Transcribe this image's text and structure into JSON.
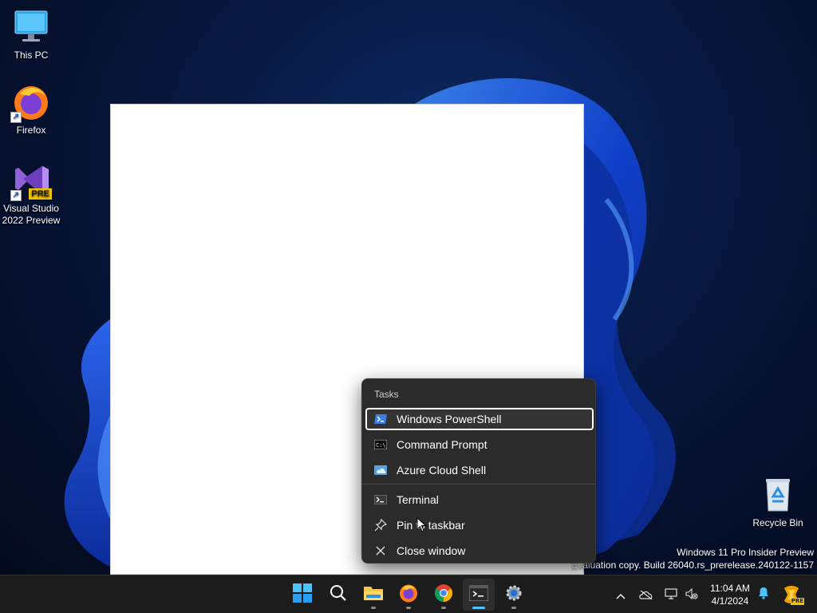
{
  "desktop": {
    "icons": [
      {
        "label": "This PC",
        "icon": "monitor-icon"
      },
      {
        "label": "Firefox",
        "icon": "firefox-icon"
      },
      {
        "label": "Visual Studio 2022 Preview",
        "icon": "visual-studio-icon",
        "badge": "PRE"
      },
      {
        "label": "Recycle Bin",
        "icon": "recycle-bin-icon"
      }
    ],
    "watermark": {
      "line1": "Windows 11 Pro Insider Preview",
      "line2": "Evaluation copy. Build 26040.rs_prerelease.240122-1157"
    }
  },
  "jumplist": {
    "section_title": "Tasks",
    "profiles": [
      {
        "label": "Windows PowerShell",
        "icon": "powershell-icon",
        "selected": true
      },
      {
        "label": "Command Prompt",
        "icon": "command-prompt-icon",
        "selected": false
      },
      {
        "label": "Azure Cloud Shell",
        "icon": "azure-cloud-shell-icon",
        "selected": false
      }
    ],
    "actions": [
      {
        "label": "Terminal",
        "icon": "terminal-icon"
      },
      {
        "label": "Pin to taskbar",
        "icon": "pin-icon"
      },
      {
        "label": "Close window",
        "icon": "close-icon"
      }
    ]
  },
  "taskbar": {
    "apps": [
      {
        "name": "Start",
        "icon": "windows-start-icon"
      },
      {
        "name": "Search",
        "icon": "search-icon"
      },
      {
        "name": "File Explorer",
        "icon": "file-explorer-icon",
        "running": true
      },
      {
        "name": "Firefox",
        "icon": "firefox-icon",
        "running": true
      },
      {
        "name": "Google Chrome",
        "icon": "chrome-icon",
        "running": true
      },
      {
        "name": "Terminal",
        "icon": "terminal-icon",
        "running": true,
        "active": true
      },
      {
        "name": "Settings",
        "icon": "settings-gear-icon",
        "running": true
      }
    ],
    "clock": {
      "time": "11:04 AM",
      "date": "4/1/2024"
    }
  },
  "colors": {
    "accent": "#4cc2ff",
    "taskbar_bg": "#1c1c1c",
    "menu_bg": "#2b2b2b",
    "bloom_blue": "#1a5cff"
  }
}
